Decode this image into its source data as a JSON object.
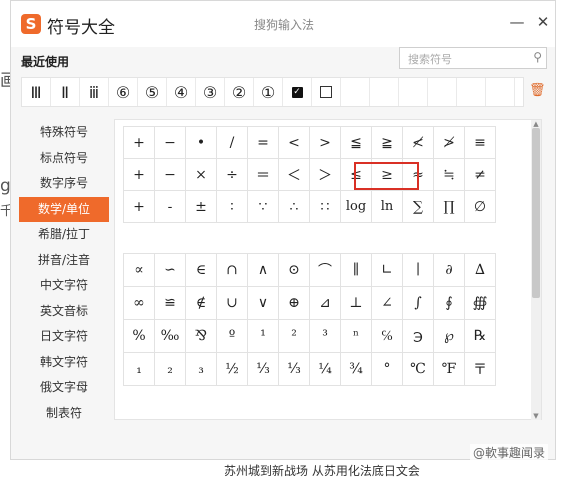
{
  "background": {
    "chars": [
      "画",
      "g",
      "千"
    ],
    "bottom_text": "苏州城到新战场 从苏用化法底日文会"
  },
  "window": {
    "app_title": "符号大全",
    "center_title": "搜狗输入法",
    "logo_letter": "S",
    "min_icon": "—",
    "close_icon": "✕"
  },
  "recent": {
    "label": "最近使用",
    "items": [
      "Ⅲ",
      "Ⅱ",
      "ⅲ",
      "⑥",
      "⑤",
      "④",
      "③",
      "②",
      "①",
      "☑",
      "☐",
      "",
      "",
      "",
      "",
      "",
      ""
    ]
  },
  "search": {
    "placeholder": "搜索符号"
  },
  "sidebar": {
    "items": [
      "特殊符号",
      "标点符号",
      "数字序号",
      "数学/单位",
      "希腊/拉丁",
      "拼音/注音",
      "中文字符",
      "英文音标",
      "日文字符",
      "韩文字符",
      "俄文字母",
      "制表符"
    ],
    "active_index": 3
  },
  "symbols_top": [
    [
      "+",
      "−",
      "•",
      "/",
      "=",
      "<",
      ">",
      "≦",
      "≧",
      "≮",
      "≯",
      "≡"
    ],
    [
      "+",
      "−",
      "×",
      "÷",
      "＝",
      "＜",
      "＞",
      "≤",
      "≥",
      "≈",
      "≒",
      "≠"
    ],
    [
      "+",
      "-",
      "±",
      "∶",
      "∵",
      "∴",
      "∷",
      "log",
      "ln",
      "∑",
      "∏",
      "∅"
    ]
  ],
  "symbols_bottom": [
    [
      "∝",
      "∽",
      "∈",
      "∩",
      "∧",
      "⊙",
      "⌒",
      "∥",
      "∟",
      "∣",
      "∂",
      "∆"
    ],
    [
      "∞",
      "≌",
      "∉",
      "∪",
      "∨",
      "⊕",
      "⊿",
      "⊥",
      "∠",
      "∫",
      "∮",
      "∰"
    ],
    [
      "%",
      "‰",
      "⅋",
      "º",
      "¹",
      "²",
      "³",
      "ⁿ",
      "℅",
      "℈",
      "℘",
      "℞"
    ],
    [
      "₁",
      "₂",
      "₃",
      "½",
      "⅓",
      "⅓",
      "¼",
      "¾",
      "°",
      "℃",
      "℉",
      "〒"
    ]
  ],
  "watermark": "@軟事趣闻录",
  "colors": {
    "accent": "#ef6a2b",
    "highlight": "#d93025"
  }
}
